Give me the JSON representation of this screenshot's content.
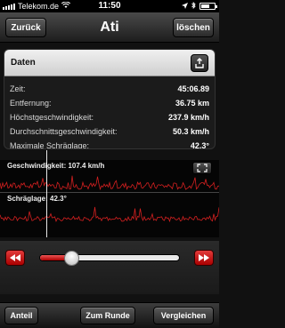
{
  "statusbar": {
    "carrier": "Telekom.de",
    "time": "11:50"
  },
  "nav": {
    "back_label": "Zurück",
    "title": "Ati",
    "delete_label": "löschen"
  },
  "card": {
    "header": "Daten",
    "rows": [
      {
        "label": "Zeit:",
        "value": "45:06.89"
      },
      {
        "label": "Entfernung:",
        "value": "36.75 km"
      },
      {
        "label": "Höchstgeschwindigkeit:",
        "value": "237.9 km/h"
      },
      {
        "label": "Durchschnittsgeschwindigkeit:",
        "value": "50.3 km/h"
      },
      {
        "label": "Maximale Schräglage:",
        "value": "42.3°"
      }
    ]
  },
  "speed_chart": {
    "label": "Geschwindigkeit: 107.4 km/h",
    "color": "#d42020"
  },
  "lean_chart": {
    "label": "Schräglage: 42.3°",
    "color": "#d42020"
  },
  "playback": {
    "position": 0.22,
    "accent": "#cc1111"
  },
  "toolbar": {
    "share_label": "Anteil",
    "round_label": "Zum Runde",
    "compare_label": "Vergleichen"
  }
}
